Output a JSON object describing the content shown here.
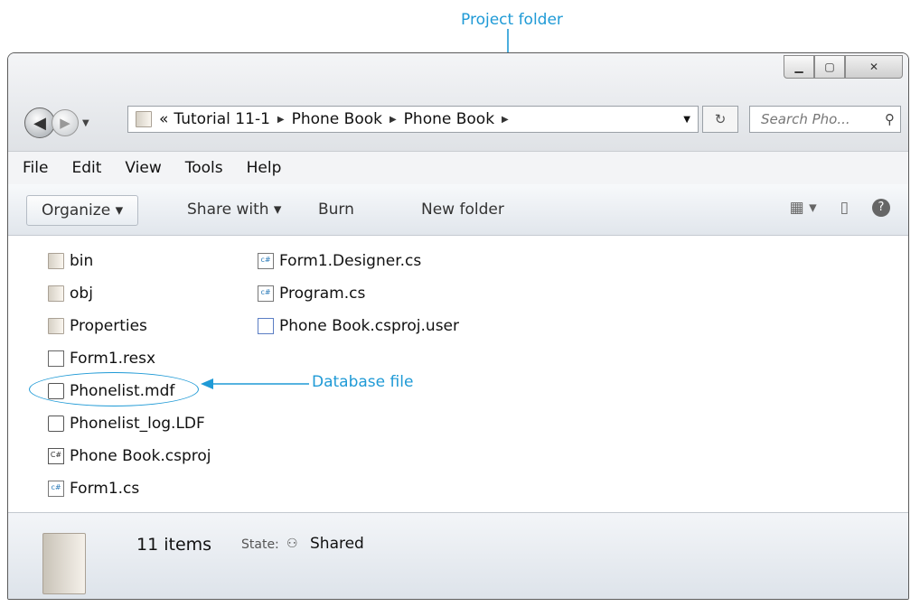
{
  "annotations": {
    "project_folder": "Project folder",
    "database_file": "Database file"
  },
  "address": {
    "overflow": "«",
    "crumbs": [
      "Tutorial 11-1",
      "Phone Book",
      "Phone Book"
    ]
  },
  "search": {
    "placeholder": "Search Pho..."
  },
  "menu": [
    "File",
    "Edit",
    "View",
    "Tools",
    "Help"
  ],
  "toolbar": {
    "organize": "Organize ▾",
    "share": "Share with ▾",
    "burn": "Burn",
    "new_folder": "New folder"
  },
  "files": {
    "col1": [
      "bin",
      "obj",
      "Properties",
      "Form1.resx",
      "Phonelist.mdf",
      "Phonelist_log.LDF",
      "Phone Book.csproj",
      "Form1.cs"
    ],
    "col2": [
      "Form1.Designer.cs",
      "Program.cs",
      "Phone Book.csproj.user"
    ]
  },
  "status": {
    "count": "11 items",
    "state_label": "State:",
    "state_value": "Shared"
  },
  "colors": {
    "annotation": "#1f9ad6"
  }
}
